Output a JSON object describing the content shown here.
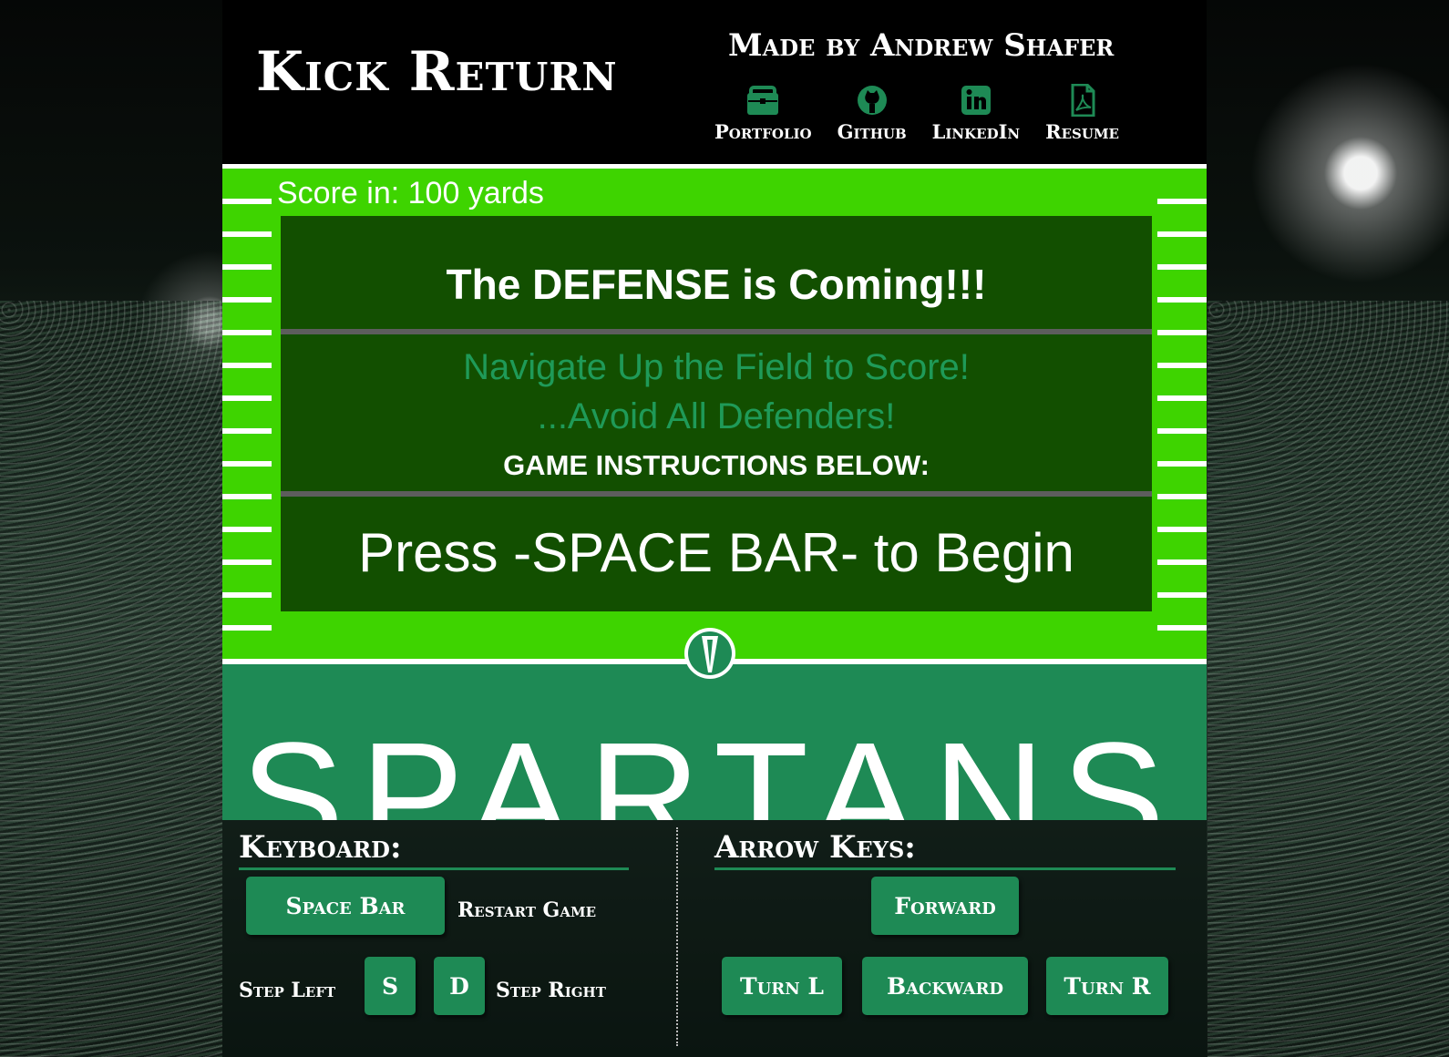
{
  "header": {
    "title": "Kick Return",
    "author": "Made by Andrew Shafer",
    "links": [
      {
        "label": "Portfolio",
        "icon": "briefcase-icon"
      },
      {
        "label": "Github",
        "icon": "github-icon"
      },
      {
        "label": "LinkedIn",
        "icon": "linkedin-icon"
      },
      {
        "label": "Resume",
        "icon": "pdf-icon"
      }
    ]
  },
  "game": {
    "score_text": "Score in: 100 yards",
    "headline": "The DEFENSE is Coming!!!",
    "subline1": "Navigate Up the Field to Score!",
    "subline2": "...Avoid All Defenders!",
    "instructions_label": "GAME INSTRUCTIONS BELOW:",
    "start_prompt": "Press -SPACE BAR- to Begin",
    "wordmark": "SPARTANS"
  },
  "controls": {
    "keyboard": {
      "title": "Keyboard:",
      "space_bar": "Space Bar",
      "restart_label": "Restart Game",
      "step_left_label": "Step Left",
      "s_key": "S",
      "d_key": "D",
      "step_right_label": "Step Right"
    },
    "arrows": {
      "title": "Arrow Keys:",
      "forward": "Forward",
      "turn_l": "Turn L",
      "backward": "Backward",
      "turn_r": "Turn R"
    }
  },
  "colors": {
    "turf": "#3ed400",
    "spartan_green": "#1e8a55",
    "board": "#124f00"
  }
}
